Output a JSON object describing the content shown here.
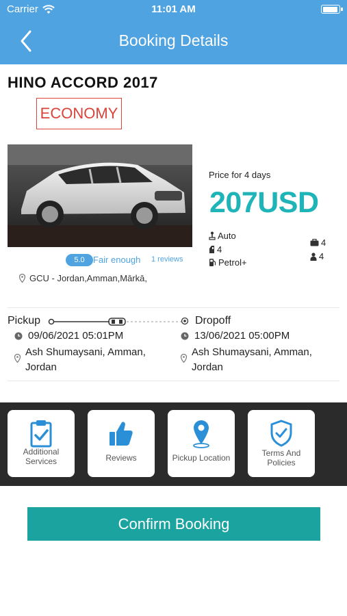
{
  "status_bar": {
    "carrier": "Carrier",
    "time": "11:01 AM"
  },
  "nav": {
    "title": "Booking Details"
  },
  "car": {
    "name": "HINO ACCORD 2017",
    "class": "ECONOMY",
    "rating": "5.0",
    "rating_text": "Fair enough",
    "reviews": "1 reviews",
    "branch": "GCU - Jordan,Amman,Mārkā,"
  },
  "price": {
    "label": "Price for 4 days",
    "value": "207USD"
  },
  "specs": {
    "transmission": "Auto",
    "doors": "4",
    "fuel": "Petrol+",
    "luggage": "4",
    "seats": "4"
  },
  "trip": {
    "pickup_label": "Pickup",
    "dropoff_label": "Dropoff",
    "pickup_datetime": "09/06/2021 05:01PM",
    "dropoff_datetime": "13/06/2021 05:00PM",
    "pickup_address_line1": "Ash Shumaysani, Amman,",
    "pickup_address_line2": "Jordan",
    "dropoff_address_line1": "Ash Shumaysani, Amman,",
    "dropoff_address_line2": "Jordan"
  },
  "actions": [
    {
      "label_line1": "Additional",
      "label_line2": "Services",
      "icon": "clipboard-check-icon"
    },
    {
      "label_line1": "Reviews",
      "label_line2": "",
      "icon": "thumbs-up-icon"
    },
    {
      "label_line1": "Pickup Location",
      "label_line2": "",
      "icon": "map-pin-icon"
    },
    {
      "label_line1": "Terms And",
      "label_line2": "Policies",
      "icon": "shield-check-icon"
    }
  ],
  "confirm_label": "Confirm  Booking",
  "colors": {
    "nav_blue": "#4fa3e0",
    "price_teal": "#1fb5b8",
    "confirm_teal": "#1aa39f",
    "economy_red": "#d9433a",
    "strip_dark": "#2b2b2b"
  }
}
